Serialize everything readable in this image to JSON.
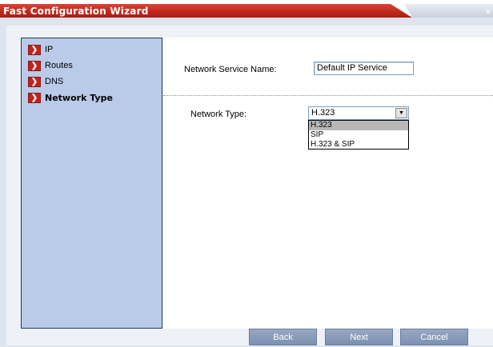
{
  "window": {
    "title": "Fast Configuration Wizard",
    "close_glyph": "×"
  },
  "nav": {
    "items": [
      {
        "label": "IP",
        "active": false
      },
      {
        "label": "Routes",
        "active": false
      },
      {
        "label": "DNS",
        "active": false
      },
      {
        "label": "Network Type",
        "active": true
      }
    ],
    "arrow_glyph": "❯"
  },
  "form": {
    "service_name_label": "Network Service Name:",
    "service_name_value": "Default IP Service",
    "network_type_label": "Network Type:",
    "network_type_value": "H.323",
    "network_type_options": [
      "H.323",
      "SIP",
      "H.323 & SIP"
    ]
  },
  "footer": {
    "back_label": "Back",
    "next_label": "Next",
    "cancel_label": "Cancel"
  },
  "colors": {
    "title_bar": "#c0281c",
    "nav_bg": "#b9cbe8",
    "arrow_bg": "#c0231a",
    "button_bg": "#8a9bba"
  }
}
